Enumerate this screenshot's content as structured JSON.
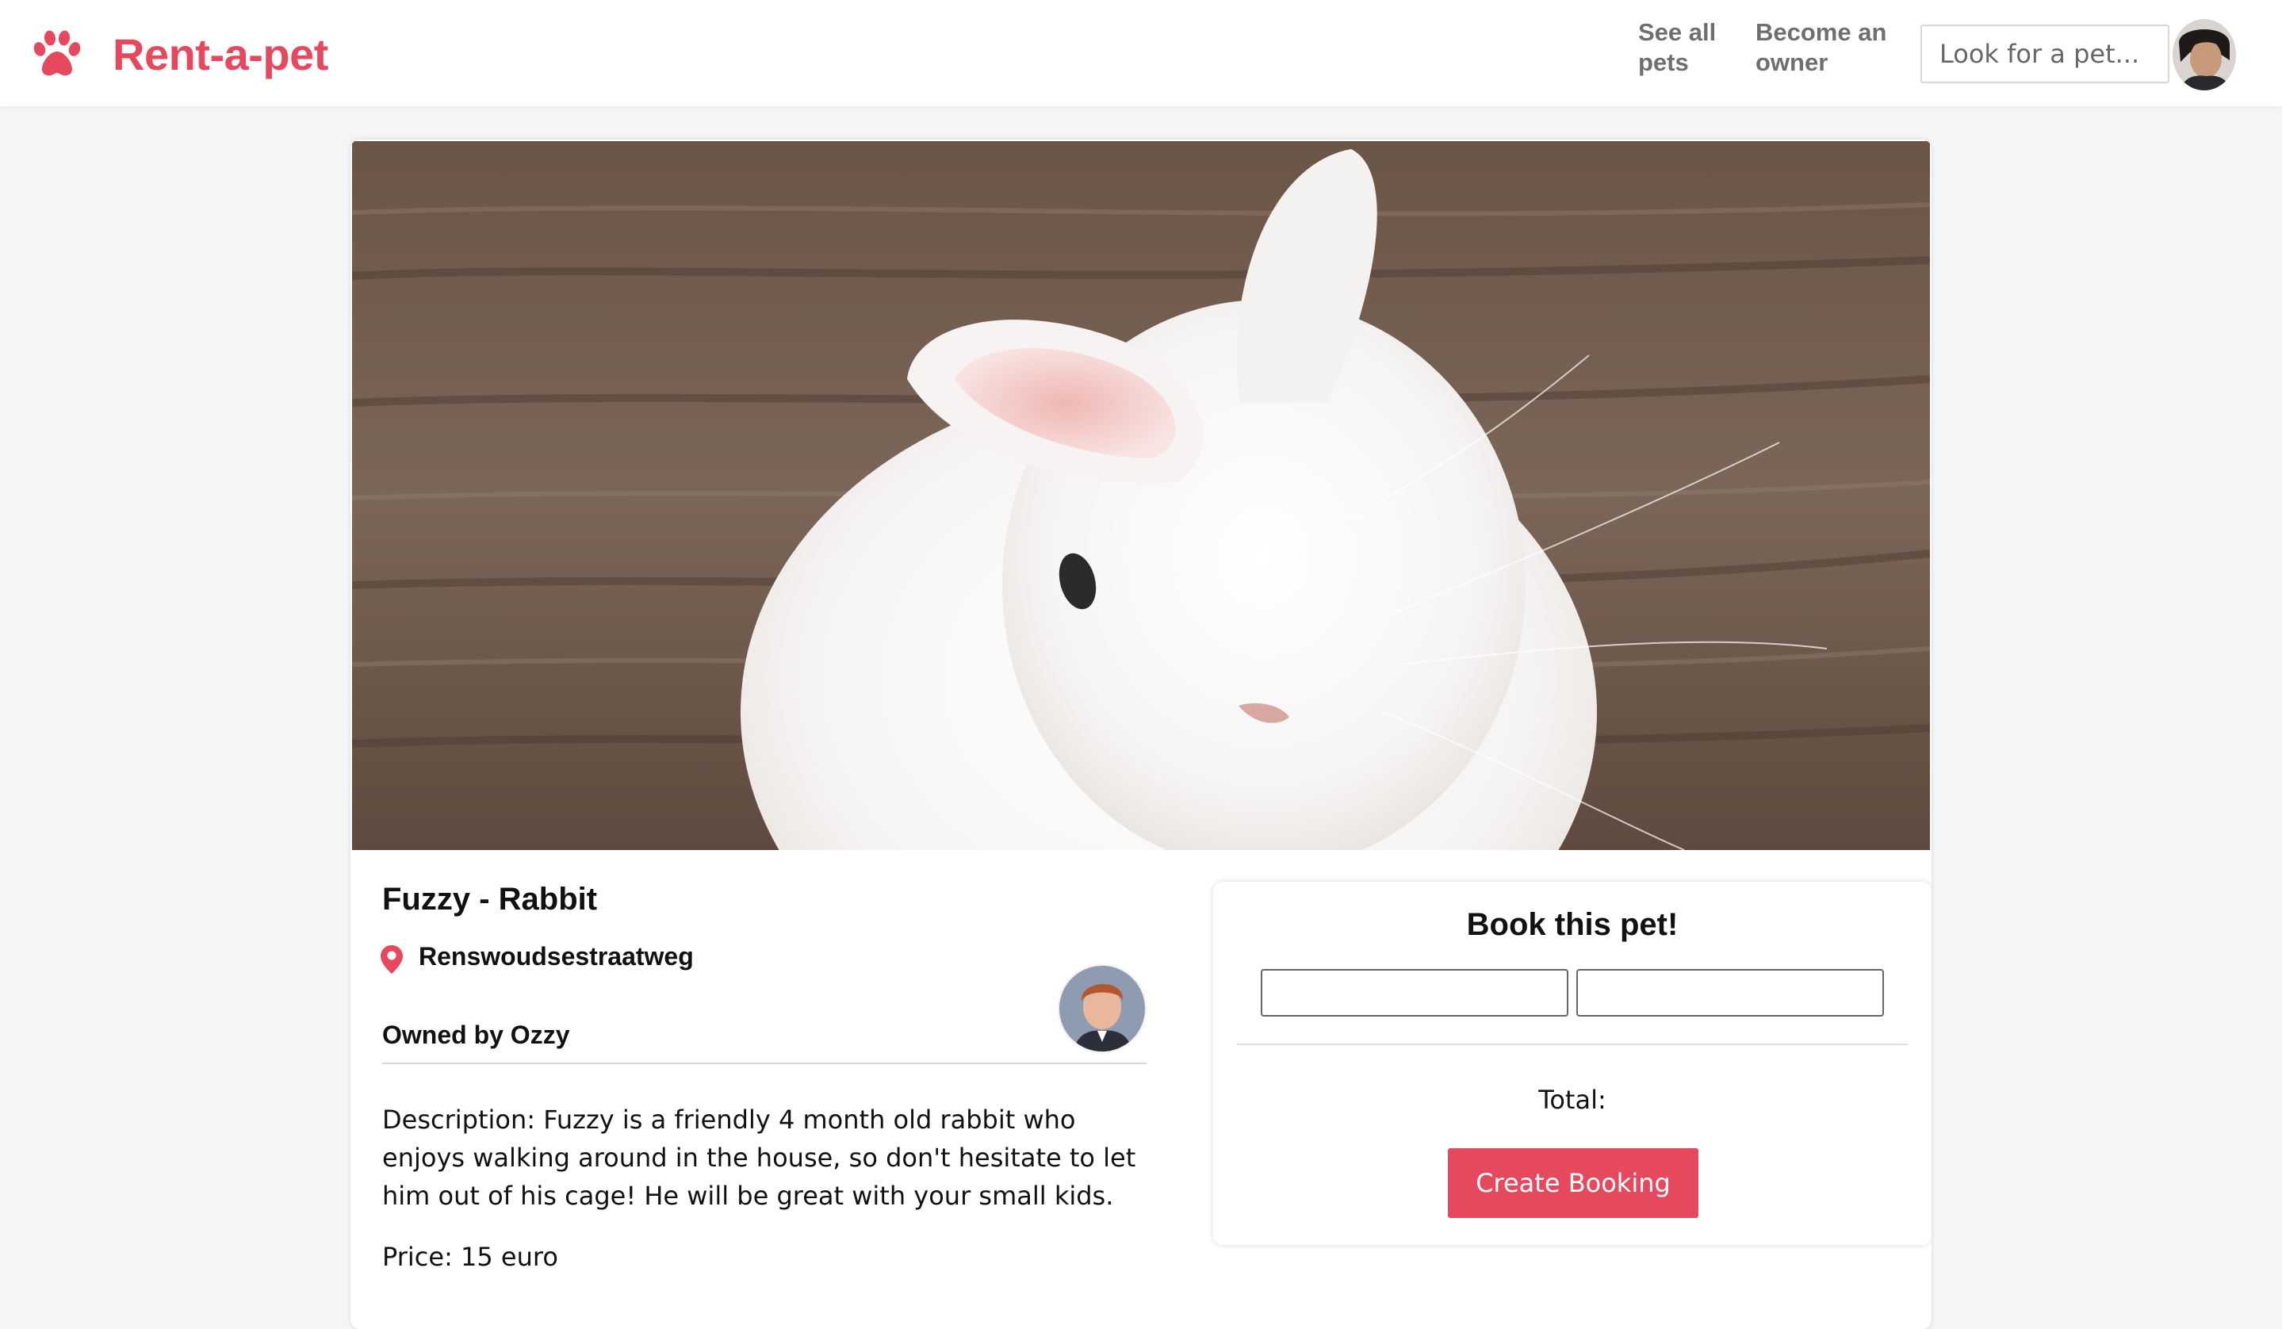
{
  "app": {
    "brand_name": "Rent-a-pet",
    "brand_icon": "paw-icon",
    "accent_color": "#e6495e"
  },
  "nav": {
    "see_all": "See all pets",
    "become_owner": "Become an owner",
    "search_placeholder": "Look for a pet...",
    "user_avatar": "user-avatar"
  },
  "pet": {
    "title": "Fuzzy - Rabbit",
    "location_icon": "map-pin-icon",
    "location": "Renswoudsestraatweg",
    "owner_label": "Owned by Ozzy",
    "owner_avatar": "owner-avatar",
    "description": "Description: Fuzzy is a friendly 4 month old rabbit who enjoys walking around in the house, so don't hesitate to let him out of his cage! He will be great with your small kids.",
    "price": "Price: 15 euro",
    "photo": "white rabbit photo"
  },
  "booking": {
    "title": "Book this pet!",
    "start_date_value": "",
    "end_date_value": "",
    "total_label": "Total:",
    "create_button": "Create Booking"
  }
}
